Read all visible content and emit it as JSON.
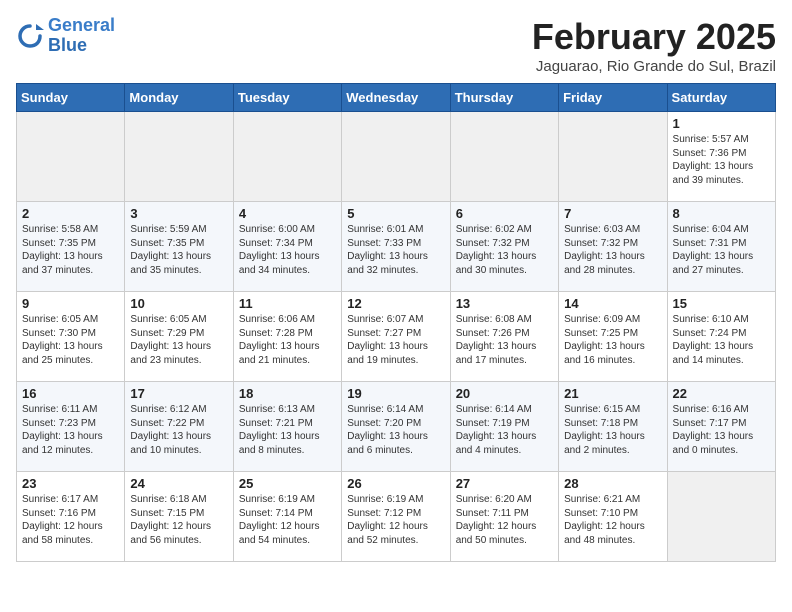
{
  "header": {
    "logo_line1": "General",
    "logo_line2": "Blue",
    "title": "February 2025",
    "subtitle": "Jaguarao, Rio Grande do Sul, Brazil"
  },
  "weekdays": [
    "Sunday",
    "Monday",
    "Tuesday",
    "Wednesday",
    "Thursday",
    "Friday",
    "Saturday"
  ],
  "weeks": [
    [
      {
        "day": "",
        "info": ""
      },
      {
        "day": "",
        "info": ""
      },
      {
        "day": "",
        "info": ""
      },
      {
        "day": "",
        "info": ""
      },
      {
        "day": "",
        "info": ""
      },
      {
        "day": "",
        "info": ""
      },
      {
        "day": "1",
        "info": "Sunrise: 5:57 AM\nSunset: 7:36 PM\nDaylight: 13 hours\nand 39 minutes."
      }
    ],
    [
      {
        "day": "2",
        "info": "Sunrise: 5:58 AM\nSunset: 7:35 PM\nDaylight: 13 hours\nand 37 minutes."
      },
      {
        "day": "3",
        "info": "Sunrise: 5:59 AM\nSunset: 7:35 PM\nDaylight: 13 hours\nand 35 minutes."
      },
      {
        "day": "4",
        "info": "Sunrise: 6:00 AM\nSunset: 7:34 PM\nDaylight: 13 hours\nand 34 minutes."
      },
      {
        "day": "5",
        "info": "Sunrise: 6:01 AM\nSunset: 7:33 PM\nDaylight: 13 hours\nand 32 minutes."
      },
      {
        "day": "6",
        "info": "Sunrise: 6:02 AM\nSunset: 7:32 PM\nDaylight: 13 hours\nand 30 minutes."
      },
      {
        "day": "7",
        "info": "Sunrise: 6:03 AM\nSunset: 7:32 PM\nDaylight: 13 hours\nand 28 minutes."
      },
      {
        "day": "8",
        "info": "Sunrise: 6:04 AM\nSunset: 7:31 PM\nDaylight: 13 hours\nand 27 minutes."
      }
    ],
    [
      {
        "day": "9",
        "info": "Sunrise: 6:05 AM\nSunset: 7:30 PM\nDaylight: 13 hours\nand 25 minutes."
      },
      {
        "day": "10",
        "info": "Sunrise: 6:05 AM\nSunset: 7:29 PM\nDaylight: 13 hours\nand 23 minutes."
      },
      {
        "day": "11",
        "info": "Sunrise: 6:06 AM\nSunset: 7:28 PM\nDaylight: 13 hours\nand 21 minutes."
      },
      {
        "day": "12",
        "info": "Sunrise: 6:07 AM\nSunset: 7:27 PM\nDaylight: 13 hours\nand 19 minutes."
      },
      {
        "day": "13",
        "info": "Sunrise: 6:08 AM\nSunset: 7:26 PM\nDaylight: 13 hours\nand 17 minutes."
      },
      {
        "day": "14",
        "info": "Sunrise: 6:09 AM\nSunset: 7:25 PM\nDaylight: 13 hours\nand 16 minutes."
      },
      {
        "day": "15",
        "info": "Sunrise: 6:10 AM\nSunset: 7:24 PM\nDaylight: 13 hours\nand 14 minutes."
      }
    ],
    [
      {
        "day": "16",
        "info": "Sunrise: 6:11 AM\nSunset: 7:23 PM\nDaylight: 13 hours\nand 12 minutes."
      },
      {
        "day": "17",
        "info": "Sunrise: 6:12 AM\nSunset: 7:22 PM\nDaylight: 13 hours\nand 10 minutes."
      },
      {
        "day": "18",
        "info": "Sunrise: 6:13 AM\nSunset: 7:21 PM\nDaylight: 13 hours\nand 8 minutes."
      },
      {
        "day": "19",
        "info": "Sunrise: 6:14 AM\nSunset: 7:20 PM\nDaylight: 13 hours\nand 6 minutes."
      },
      {
        "day": "20",
        "info": "Sunrise: 6:14 AM\nSunset: 7:19 PM\nDaylight: 13 hours\nand 4 minutes."
      },
      {
        "day": "21",
        "info": "Sunrise: 6:15 AM\nSunset: 7:18 PM\nDaylight: 13 hours\nand 2 minutes."
      },
      {
        "day": "22",
        "info": "Sunrise: 6:16 AM\nSunset: 7:17 PM\nDaylight: 13 hours\nand 0 minutes."
      }
    ],
    [
      {
        "day": "23",
        "info": "Sunrise: 6:17 AM\nSunset: 7:16 PM\nDaylight: 12 hours\nand 58 minutes."
      },
      {
        "day": "24",
        "info": "Sunrise: 6:18 AM\nSunset: 7:15 PM\nDaylight: 12 hours\nand 56 minutes."
      },
      {
        "day": "25",
        "info": "Sunrise: 6:19 AM\nSunset: 7:14 PM\nDaylight: 12 hours\nand 54 minutes."
      },
      {
        "day": "26",
        "info": "Sunrise: 6:19 AM\nSunset: 7:12 PM\nDaylight: 12 hours\nand 52 minutes."
      },
      {
        "day": "27",
        "info": "Sunrise: 6:20 AM\nSunset: 7:11 PM\nDaylight: 12 hours\nand 50 minutes."
      },
      {
        "day": "28",
        "info": "Sunrise: 6:21 AM\nSunset: 7:10 PM\nDaylight: 12 hours\nand 48 minutes."
      },
      {
        "day": "",
        "info": ""
      }
    ]
  ]
}
